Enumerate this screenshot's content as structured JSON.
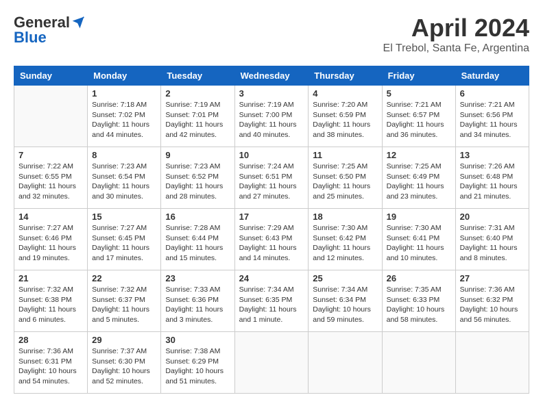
{
  "header": {
    "logo_general": "General",
    "logo_blue": "Blue",
    "month_title": "April 2024",
    "location": "El Trebol, Santa Fe, Argentina"
  },
  "days_of_week": [
    "Sunday",
    "Monday",
    "Tuesday",
    "Wednesday",
    "Thursday",
    "Friday",
    "Saturday"
  ],
  "weeks": [
    [
      {
        "day": "",
        "info": ""
      },
      {
        "day": "1",
        "info": "Sunrise: 7:18 AM\nSunset: 7:02 PM\nDaylight: 11 hours\nand 44 minutes."
      },
      {
        "day": "2",
        "info": "Sunrise: 7:19 AM\nSunset: 7:01 PM\nDaylight: 11 hours\nand 42 minutes."
      },
      {
        "day": "3",
        "info": "Sunrise: 7:19 AM\nSunset: 7:00 PM\nDaylight: 11 hours\nand 40 minutes."
      },
      {
        "day": "4",
        "info": "Sunrise: 7:20 AM\nSunset: 6:59 PM\nDaylight: 11 hours\nand 38 minutes."
      },
      {
        "day": "5",
        "info": "Sunrise: 7:21 AM\nSunset: 6:57 PM\nDaylight: 11 hours\nand 36 minutes."
      },
      {
        "day": "6",
        "info": "Sunrise: 7:21 AM\nSunset: 6:56 PM\nDaylight: 11 hours\nand 34 minutes."
      }
    ],
    [
      {
        "day": "7",
        "info": "Sunrise: 7:22 AM\nSunset: 6:55 PM\nDaylight: 11 hours\nand 32 minutes."
      },
      {
        "day": "8",
        "info": "Sunrise: 7:23 AM\nSunset: 6:54 PM\nDaylight: 11 hours\nand 30 minutes."
      },
      {
        "day": "9",
        "info": "Sunrise: 7:23 AM\nSunset: 6:52 PM\nDaylight: 11 hours\nand 28 minutes."
      },
      {
        "day": "10",
        "info": "Sunrise: 7:24 AM\nSunset: 6:51 PM\nDaylight: 11 hours\nand 27 minutes."
      },
      {
        "day": "11",
        "info": "Sunrise: 7:25 AM\nSunset: 6:50 PM\nDaylight: 11 hours\nand 25 minutes."
      },
      {
        "day": "12",
        "info": "Sunrise: 7:25 AM\nSunset: 6:49 PM\nDaylight: 11 hours\nand 23 minutes."
      },
      {
        "day": "13",
        "info": "Sunrise: 7:26 AM\nSunset: 6:48 PM\nDaylight: 11 hours\nand 21 minutes."
      }
    ],
    [
      {
        "day": "14",
        "info": "Sunrise: 7:27 AM\nSunset: 6:46 PM\nDaylight: 11 hours\nand 19 minutes."
      },
      {
        "day": "15",
        "info": "Sunrise: 7:27 AM\nSunset: 6:45 PM\nDaylight: 11 hours\nand 17 minutes."
      },
      {
        "day": "16",
        "info": "Sunrise: 7:28 AM\nSunset: 6:44 PM\nDaylight: 11 hours\nand 15 minutes."
      },
      {
        "day": "17",
        "info": "Sunrise: 7:29 AM\nSunset: 6:43 PM\nDaylight: 11 hours\nand 14 minutes."
      },
      {
        "day": "18",
        "info": "Sunrise: 7:30 AM\nSunset: 6:42 PM\nDaylight: 11 hours\nand 12 minutes."
      },
      {
        "day": "19",
        "info": "Sunrise: 7:30 AM\nSunset: 6:41 PM\nDaylight: 11 hours\nand 10 minutes."
      },
      {
        "day": "20",
        "info": "Sunrise: 7:31 AM\nSunset: 6:40 PM\nDaylight: 11 hours\nand 8 minutes."
      }
    ],
    [
      {
        "day": "21",
        "info": "Sunrise: 7:32 AM\nSunset: 6:38 PM\nDaylight: 11 hours\nand 6 minutes."
      },
      {
        "day": "22",
        "info": "Sunrise: 7:32 AM\nSunset: 6:37 PM\nDaylight: 11 hours\nand 5 minutes."
      },
      {
        "day": "23",
        "info": "Sunrise: 7:33 AM\nSunset: 6:36 PM\nDaylight: 11 hours\nand 3 minutes."
      },
      {
        "day": "24",
        "info": "Sunrise: 7:34 AM\nSunset: 6:35 PM\nDaylight: 11 hours\nand 1 minute."
      },
      {
        "day": "25",
        "info": "Sunrise: 7:34 AM\nSunset: 6:34 PM\nDaylight: 10 hours\nand 59 minutes."
      },
      {
        "day": "26",
        "info": "Sunrise: 7:35 AM\nSunset: 6:33 PM\nDaylight: 10 hours\nand 58 minutes."
      },
      {
        "day": "27",
        "info": "Sunrise: 7:36 AM\nSunset: 6:32 PM\nDaylight: 10 hours\nand 56 minutes."
      }
    ],
    [
      {
        "day": "28",
        "info": "Sunrise: 7:36 AM\nSunset: 6:31 PM\nDaylight: 10 hours\nand 54 minutes."
      },
      {
        "day": "29",
        "info": "Sunrise: 7:37 AM\nSunset: 6:30 PM\nDaylight: 10 hours\nand 52 minutes."
      },
      {
        "day": "30",
        "info": "Sunrise: 7:38 AM\nSunset: 6:29 PM\nDaylight: 10 hours\nand 51 minutes."
      },
      {
        "day": "",
        "info": ""
      },
      {
        "day": "",
        "info": ""
      },
      {
        "day": "",
        "info": ""
      },
      {
        "day": "",
        "info": ""
      }
    ]
  ]
}
